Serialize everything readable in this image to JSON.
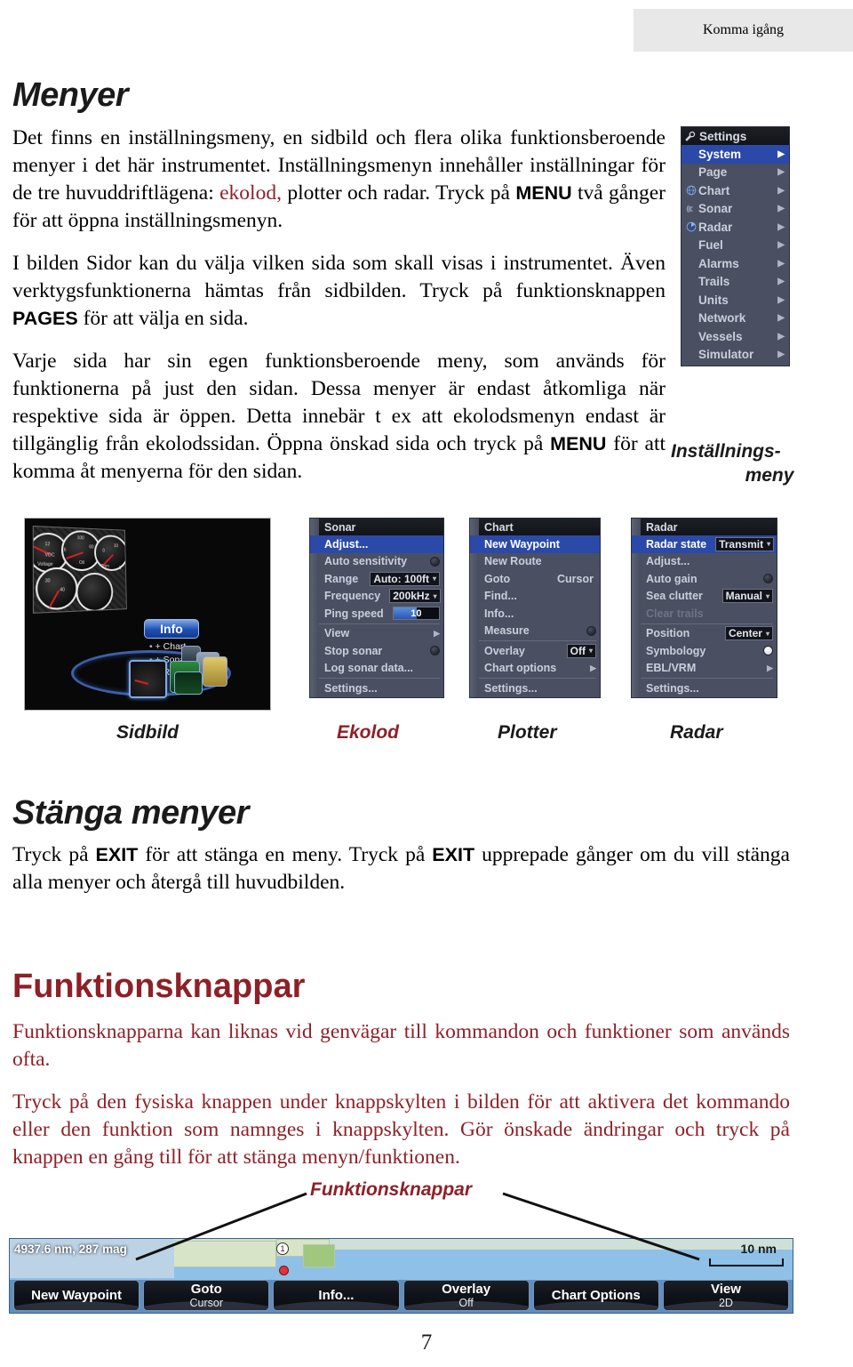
{
  "header": {
    "tab_label": "Komma igång"
  },
  "sections": {
    "menyer": {
      "heading": "Menyer",
      "p1_a": "Det finns en inställningsmeny, en sidbild och flera olika funktionsberoende menyer i det här instrumentet. Inställningsmenyn innehåller inställningar för de tre huvuddriftlägena: ",
      "p1_red": "ekolod,",
      "p1_b": " plotter och radar. Tryck på ",
      "p1_bold": "MENU",
      "p1_c": " två gånger för att öppna inställningsmenyn.",
      "p2_a": "I bilden Sidor kan du välja vilken sida som skall visas i instrumentet. Även verktygsfunktionerna hämtas från sidbilden. Tryck på funktionsknappen ",
      "p2_bold": "PAGES",
      "p2_b": " för att välja en sida.",
      "p3_a": "Varje sida har sin egen funktionsberoende meny, som används för funktionerna på just den sidan. Dessa menyer är endast åtkomliga när respektive sida är öppen. Detta innebär t ex att ekolodsmenyn endast är tillgänglig från ekolodssidan. Öppna önskad sida och tryck på ",
      "p3_bold": "MENU",
      "p3_b": " för att komma åt menyerna för den sidan."
    },
    "stanga": {
      "heading": "Stänga menyer",
      "p1_a": "Tryck på ",
      "p1_bold1": "EXIT",
      "p1_b": " för att stänga en meny. Tryck på ",
      "p1_bold2": "EXIT",
      "p1_c": " upprepade gånger om du vill stänga alla menyer och återgå till huvudbilden."
    },
    "funktionsknappar": {
      "heading": "Funktionsknappar",
      "p1": "Funktionsknapparna kan liknas vid genvägar till kommandon och funktioner som används ofta.",
      "p2": "Tryck på den fysiska knappen under knappskylten i bilden för att aktivera det kommando eller den funktion som namnges i knappskylten. Gör önskade ändringar och tryck på knappen en gång till för att stänga menyn/funktionen."
    }
  },
  "settings_menu": {
    "title": "Settings",
    "title_icon": "wrench-icon",
    "caption_line1": "Inställnings-",
    "caption_line2": "meny",
    "items": [
      {
        "label": "System",
        "icon": "none",
        "arrow": "▶",
        "selected": true
      },
      {
        "label": "Page",
        "icon": "none",
        "arrow": "▶",
        "selected": false
      },
      {
        "label": "Chart",
        "icon": "globe-icon",
        "arrow": "▶",
        "selected": false
      },
      {
        "label": "Sonar",
        "icon": "sonar-icon",
        "arrow": "▶",
        "selected": false
      },
      {
        "label": "Radar",
        "icon": "radar-icon",
        "arrow": "▶",
        "selected": false
      },
      {
        "label": "Fuel",
        "icon": "none",
        "arrow": "▶",
        "selected": false
      },
      {
        "label": "Alarms",
        "icon": "none",
        "arrow": "▶",
        "selected": false
      },
      {
        "label": "Trails",
        "icon": "none",
        "arrow": "▶",
        "selected": false
      },
      {
        "label": "Units",
        "icon": "none",
        "arrow": "▶",
        "selected": false
      },
      {
        "label": "Network",
        "icon": "none",
        "arrow": "▶",
        "selected": false
      },
      {
        "label": "Vessels",
        "icon": "none",
        "arrow": "▶",
        "selected": false
      },
      {
        "label": "Simulator",
        "icon": "none",
        "arrow": "▶",
        "selected": false
      }
    ]
  },
  "shots": {
    "sidbild": {
      "caption": "Sidbild",
      "info_pill": "Info",
      "info_items": [
        "+ Chart",
        "+ Sonar",
        "+ Radar"
      ],
      "gauge_labels": [
        "12",
        "16",
        "VDC",
        "Voltage",
        "30",
        "40",
        "100",
        "60",
        "Oil",
        "0",
        "10",
        "Trim",
        "8"
      ]
    },
    "ekolod": {
      "caption": "Ekolod",
      "title": "Sonar",
      "rows": [
        {
          "label": "Adjust...",
          "type": "plain",
          "selected": true
        },
        {
          "label": "Auto sensitivity",
          "type": "radio",
          "value": "off"
        },
        {
          "label": "Range",
          "type": "combo",
          "value": "Auto: 100ft"
        },
        {
          "label": "Frequency",
          "type": "combo",
          "value": "200kHz"
        },
        {
          "label": "Ping speed",
          "type": "slider",
          "value": "10"
        },
        {
          "label": "View",
          "type": "submenu"
        },
        {
          "label": "Stop sonar",
          "type": "radio",
          "value": "off"
        },
        {
          "label": "Log sonar data...",
          "type": "plain"
        },
        {
          "label": "Settings...",
          "type": "plain"
        }
      ]
    },
    "plotter": {
      "caption": "Plotter",
      "title": "Chart",
      "rows": [
        {
          "label": "New Waypoint",
          "type": "plain",
          "selected": true
        },
        {
          "label": "New Route",
          "type": "plain"
        },
        {
          "label": "Goto",
          "type": "value",
          "value": "Cursor"
        },
        {
          "label": "Find...",
          "type": "plain"
        },
        {
          "label": "Info...",
          "type": "plain"
        },
        {
          "label": "Measure",
          "type": "radio",
          "value": "off"
        },
        {
          "label": "Overlay",
          "type": "combo",
          "value": "Off"
        },
        {
          "label": "Chart options",
          "type": "submenu"
        },
        {
          "label": "Settings...",
          "type": "plain"
        }
      ]
    },
    "radar": {
      "caption": "Radar",
      "title": "Radar",
      "rows": [
        {
          "label": "Radar state",
          "type": "combo",
          "value": "Transmit",
          "selected": true
        },
        {
          "label": "Adjust...",
          "type": "plain"
        },
        {
          "label": "Auto gain",
          "type": "radio",
          "value": "off"
        },
        {
          "label": "Sea clutter",
          "type": "combo",
          "value": "Manual"
        },
        {
          "label": "Clear trails",
          "type": "plain",
          "disabled": true
        },
        {
          "label": "Position",
          "type": "combo",
          "value": "Center"
        },
        {
          "label": "Symbology",
          "type": "radio",
          "value": "on"
        },
        {
          "label": "EBL/VRM",
          "type": "submenu"
        },
        {
          "label": "Settings...",
          "type": "plain"
        }
      ]
    }
  },
  "callout": {
    "label": "Funktionsknappar"
  },
  "bottom_bar": {
    "nav_readout": "4937.6 nm, 287 mag",
    "scale": "10 nm",
    "softkeys": [
      {
        "main": "New Waypoint",
        "sub": ""
      },
      {
        "main": "Goto",
        "sub": "Cursor"
      },
      {
        "main": "Info...",
        "sub": ""
      },
      {
        "main": "Overlay",
        "sub": "Off"
      },
      {
        "main": "Chart Options",
        "sub": ""
      },
      {
        "main": "View",
        "sub": "2D"
      }
    ]
  },
  "page_number": "7",
  "colors": {
    "accent_red": "#8e2027",
    "menu_bg": "#4a5062",
    "menu_selected": "#2b49a8",
    "header_tab_bg": "#e8e8e8"
  }
}
